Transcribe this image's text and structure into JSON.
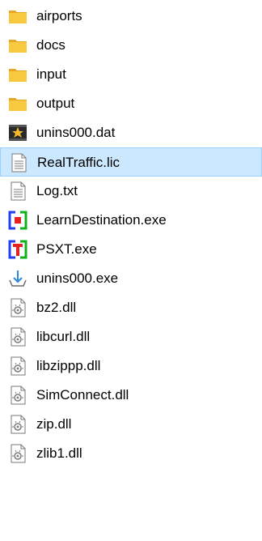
{
  "file_list": {
    "items": [
      {
        "name": "airports",
        "icon": "folder-icon",
        "selected": false
      },
      {
        "name": "docs",
        "icon": "folder-icon",
        "selected": false
      },
      {
        "name": "input",
        "icon": "folder-icon",
        "selected": false
      },
      {
        "name": "output",
        "icon": "folder-icon",
        "selected": false
      },
      {
        "name": "unins000.dat",
        "icon": "dat-file-icon",
        "selected": false
      },
      {
        "name": "RealTraffic.lic",
        "icon": "text-file-icon",
        "selected": true
      },
      {
        "name": "Log.txt",
        "icon": "text-file-icon",
        "selected": false
      },
      {
        "name": "LearnDestination.exe",
        "icon": "learn-destination-app-icon",
        "selected": false
      },
      {
        "name": "PSXT.exe",
        "icon": "psxt-app-icon",
        "selected": false
      },
      {
        "name": "unins000.exe",
        "icon": "installer-icon",
        "selected": false
      },
      {
        "name": "bz2.dll",
        "icon": "dll-file-icon",
        "selected": false
      },
      {
        "name": "libcurl.dll",
        "icon": "dll-file-icon",
        "selected": false
      },
      {
        "name": "libzippp.dll",
        "icon": "dll-file-icon",
        "selected": false
      },
      {
        "name": "SimConnect.dll",
        "icon": "dll-file-icon",
        "selected": false
      },
      {
        "name": "zip.dll",
        "icon": "dll-file-icon",
        "selected": false
      },
      {
        "name": "zlib1.dll",
        "icon": "dll-file-icon",
        "selected": false
      }
    ]
  },
  "colors": {
    "selection_background": "#cce8ff",
    "selection_border": "#99d1ff",
    "folder_yellow": "#f8c93e",
    "psxt_red": "#e32222",
    "learn_blue": "#1f3cff",
    "learn_green": "#10b01a",
    "installer_blue": "#2b88d8"
  }
}
